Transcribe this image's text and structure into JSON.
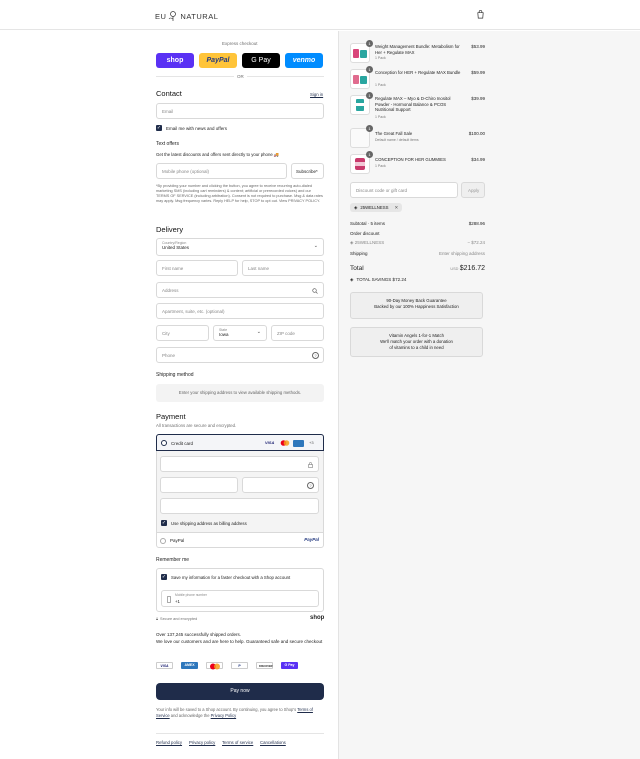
{
  "header": {
    "logo_text_left": "EU",
    "logo_text_right": "NATURAL"
  },
  "express": {
    "label": "Express checkout",
    "shop": "shop",
    "paypal": "PayPal",
    "gpay": "G Pay",
    "venmo": "venmo",
    "or": "OR"
  },
  "contact": {
    "title": "Contact",
    "sign_in": "Sign in",
    "email_placeholder": "Email",
    "email_news": "Email me with news and offers"
  },
  "text_offers": {
    "title": "Text offers",
    "desc": "Get the latest discounts and offers sent directly to your phone 🚚",
    "phone_placeholder": "Mobile phone (optional)",
    "subscribe": "Subscribe*",
    "fine_print": "*By providing your number and clicking the button, you agree to receive recurring auto-dialed marketing SMS (including cart reminders) & content; artificial or prerecorded voices) and our TERMS OF SERVICE (including arbitration). Consent is not required to purchase. Msg & data rates may apply. Msg frequency varies. Reply HELP for help, STOP to opt out. View PRIVACY POLICY."
  },
  "delivery": {
    "title": "Delivery",
    "country_label": "Country/Region",
    "country_value": "United States",
    "first_name": "First name",
    "last_name": "Last name",
    "address": "Address",
    "apartment": "Apartment, suite, etc. (optional)",
    "city": "City",
    "state_label": "State",
    "state_value": "Iowa",
    "zip": "ZIP code",
    "phone": "Phone"
  },
  "shipping": {
    "title": "Shipping method",
    "placeholder": "Enter your shipping address to view available shipping methods."
  },
  "payment": {
    "title": "Payment",
    "subtitle": "All transactions are secure and encrypted.",
    "credit_card": "Credit card",
    "more_cards": "+3",
    "billing_same": "Use shipping address as billing address",
    "paypal": "PayPal",
    "paypal_logo": "PayPal"
  },
  "remember": {
    "title": "Remember me",
    "save_info": "Save my information for a faster checkout with a Shop account",
    "phone_label": "Mobile phone number",
    "phone_value": "+1",
    "secure": "Secure and encrypted",
    "shop_logo": "shop"
  },
  "trust": {
    "line1": "Over 137,245 successfully shipped orders.",
    "line2": "We love our customers and are here to help. Guaranteed safe and secure checkout"
  },
  "payment_logos": [
    "VISA",
    "AMEX",
    "MC",
    "P",
    "DISCOVER",
    "G Pay"
  ],
  "pay_now": "Pay now",
  "consent": {
    "text_a": "Your info will be saved to a Shop account. By continuing, you agree to Shop's",
    "tos": "Terms of Service",
    "text_b": "and acknowledge the",
    "privacy": "Privacy Policy"
  },
  "footer": [
    "Refund policy",
    "Privacy policy",
    "Terms of service",
    "Cancellations"
  ],
  "cart": {
    "items": [
      {
        "qty": "1",
        "name": "Weight Management Bundle: Metabolism for Her + Regulate MAX",
        "sub": "1 Pack",
        "price": "$53.99"
      },
      {
        "qty": "1",
        "name": "Conception for HER + Regulate MAX Bundle",
        "sub": "1 Pack",
        "price": "$59.99"
      },
      {
        "qty": "1",
        "name": "Regulate MAX – Myo & D-Chiro Inositol Powder - Hormonal Balance & PCOS Nutritional Support",
        "sub": "1 Pack",
        "price": "$39.99"
      },
      {
        "qty": "1",
        "name": "The Great Fall Sale",
        "sub": "Default name / default items",
        "price": "$100.00"
      },
      {
        "qty": "1",
        "name": "CONCEPTION FOR HER GUMMIES",
        "sub": "1 Pack",
        "price": "$34.99"
      }
    ],
    "discount_placeholder": "Discount code or gift card",
    "apply": "Apply",
    "code_tag": "25WELLNESS",
    "subtotal_label": "Subtotal · 5 items",
    "subtotal_value": "$288.96",
    "order_discount": "Order discount",
    "discount_code": "25WELLNESS",
    "discount_value": "− $72.24",
    "shipping_label": "Shipping",
    "shipping_value": "Enter shipping address",
    "total_label": "Total",
    "currency": "USD",
    "total_value": "$216.72",
    "savings": "TOTAL SAVINGS  $72.24",
    "guarantee_l1": "90-Day Money Back Guarantee",
    "guarantee_l2": "Backed by our 100% Happiness Satisfaction",
    "angels_l1": "Vitamin Angels 1-for-1 Match",
    "angels_l2": "We'll match your order with a donation",
    "angels_l3": "of vitamins to a child in need"
  },
  "colors": {
    "navy": "#1f2c4a",
    "shop_purple": "#5a31f4",
    "paypal_yellow": "#ffc439",
    "venmo_blue": "#008cff"
  }
}
